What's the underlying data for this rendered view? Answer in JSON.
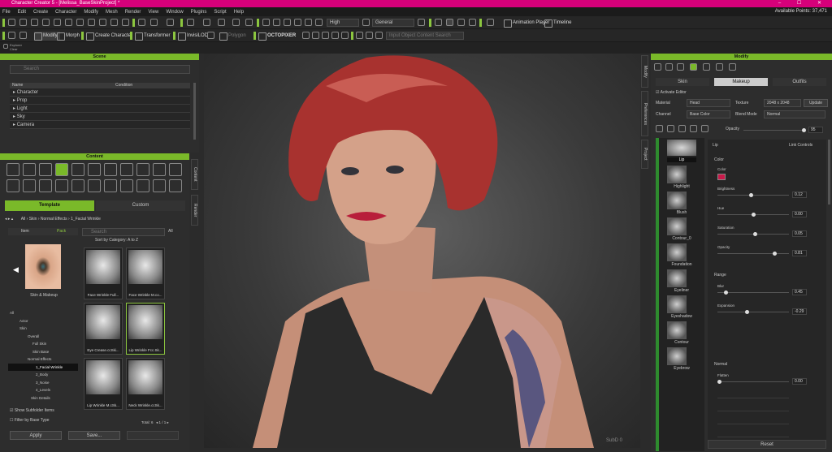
{
  "window": {
    "title": "Character Creator 5 - [Melissa_BaseSkinProject] *",
    "controls": "– ☐ ✕"
  },
  "menu": {
    "items": [
      "File",
      "Edit",
      "Create",
      "Character",
      "Modify",
      "Mesh",
      "Render",
      "View",
      "Window",
      "Plugins",
      "Script",
      "Help"
    ],
    "points": "Available Points: 37,471"
  },
  "toolbar": {
    "quality": "High",
    "mode": "General",
    "animation_player": "Animation Player",
    "timeline": "Timeline"
  },
  "toolbar2": {
    "modify": "Modify",
    "morph": "Morph",
    "create_character": "Create Character",
    "transformer": "Transformer",
    "invisilod": "InvisiLOD",
    "polygon": "Polygon",
    "octopixer": "OCTOPIXER",
    "search_placeholder": "Input Object Content Search"
  },
  "toolbar3": {
    "label1": "Explorer",
    "label2": "Clear"
  },
  "scene": {
    "header": "Scene",
    "search_placeholder": "Search",
    "col_name": "Name",
    "col_condition": "Condition",
    "items": [
      "Character",
      "Prop",
      "Light",
      "Sky",
      "Camera"
    ]
  },
  "content": {
    "header": "Content",
    "tab_template": "Template",
    "tab_custom": "Custom",
    "crumbs": [
      "All",
      "Skin",
      "Normal Effects",
      "1_Facial Wrinkle"
    ],
    "item_tab": "Item",
    "pack_tab": "Pack",
    "search_placeholder": "Search",
    "sort_label": "Sort by Category: A to Z",
    "preview_caption": "Skin & Makeup",
    "tree": [
      "All",
      "Actor",
      "Skin",
      "Overall",
      "Full Skin",
      "Skin Base",
      "Normal Effects",
      "1_Facial Wrinkle",
      "2_Body",
      "3_Noise",
      "4_Levels",
      "Skin Details"
    ],
    "tiles": [
      "Face Wrinkle Full...",
      "Face Wrinkle M.co...",
      "Eye Crease.ccSki...",
      "Lip Wrinkle Fcc.Sk...",
      "Lip Wrinkle M.cSk...",
      "Neck Wrinkle.ccSk..."
    ],
    "show_subfolder": "Show Subfolder Items",
    "filter_base": "Filter by Base Type",
    "total": "Total: 6",
    "pages": "◂  1  /  1  ▸",
    "apply": "Apply",
    "save": "Save...",
    "all_label": "All"
  },
  "side_tabs": {
    "content": "Content",
    "render": "Render",
    "modify": "Modify",
    "preferences": "Preferences",
    "project": "Project"
  },
  "viewport": {
    "watermark": "SubD 0"
  },
  "modify": {
    "header": "Modify",
    "tabs": [
      "Skin",
      "Makeup",
      "Outfits"
    ],
    "activate_editor": "Activate Editor",
    "material_label": "Material",
    "material_value": "Head",
    "texture_label": "Texture",
    "texture_value": "2048 x 2048",
    "update": "Update",
    "channel_label": "Channel",
    "channel_value": "Base Color",
    "blend_label": "Blend Mode",
    "blend_value": "Normal",
    "opacity_label": "Opacity",
    "opacity_value": "95",
    "layer_title": "Lip",
    "link_controls": "Link Controls",
    "layers": [
      "Lip",
      "Highlight",
      "Blush",
      "Contour_0",
      "Foundation",
      "Eyeliner",
      "Eyeshadow",
      "Contour",
      "Eyebrow"
    ],
    "color_section": "Color",
    "color_label": "Color",
    "color_value": "#c81a4a",
    "sliders": [
      {
        "label": "Brightness",
        "value": "0.12",
        "pos": 0.47
      },
      {
        "label": "Hue",
        "value": "0.00",
        "pos": 0.5
      },
      {
        "label": "Saturation",
        "value": "0.05",
        "pos": 0.52
      },
      {
        "label": "Opacity",
        "value": "0.81",
        "pos": 0.81
      }
    ],
    "range_section": "Range",
    "range_sliders": [
      {
        "label": "Blur",
        "value": "0.45",
        "pos": 0.1
      },
      {
        "label": "Expansion",
        "value": "-0.29",
        "pos": 0.4
      }
    ],
    "normal_section": "Normal",
    "flatten_label": "Flatten",
    "flatten_value": "0.00",
    "reset": "Reset"
  }
}
